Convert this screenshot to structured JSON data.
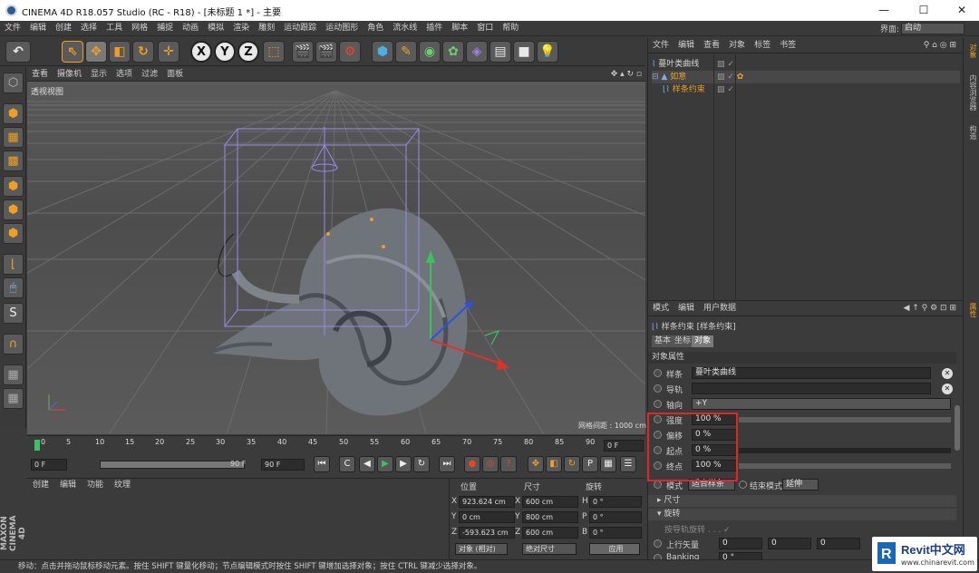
{
  "window": {
    "title": "CINEMA 4D R18.057 Studio (RC - R18) - [未标题 1 *] - 主要",
    "minimize": "—",
    "maximize": "☐",
    "close": "✕"
  },
  "menu": {
    "items": [
      "文件",
      "编辑",
      "创建",
      "选择",
      "工具",
      "网格",
      "捕捉",
      "动画",
      "模拟",
      "渲染",
      "雕刻",
      "运动跟踪",
      "运动图形",
      "角色",
      "流水线",
      "插件",
      "脚本",
      "窗口",
      "帮助"
    ],
    "layout_label": "界面:",
    "layout_value": "启动"
  },
  "viewport": {
    "menu": [
      "查看",
      "摄像机",
      "显示",
      "选项",
      "过滤",
      "面板"
    ],
    "label": "透视视图",
    "grid_spacing": "网格间距 : 1000 cm"
  },
  "timeline": {
    "ticks": [
      "0",
      "5",
      "10",
      "15",
      "20",
      "25",
      "30",
      "35",
      "40",
      "45",
      "50",
      "55",
      "60",
      "65",
      "70",
      "75",
      "80",
      "85",
      "90"
    ],
    "current_frame": "0 F"
  },
  "transport": {
    "start": "0 F",
    "min": "0 F",
    "max": "90 F",
    "end": "90 F"
  },
  "material_panel": {
    "menu": [
      "创建",
      "编辑",
      "功能",
      "纹理"
    ]
  },
  "coords": {
    "headers": [
      "位置",
      "尺寸",
      "旋转"
    ],
    "rows": [
      {
        "axis": "X",
        "pos": "923.624 cm",
        "saxis": "X",
        "size": "600 cm",
        "raxis": "H",
        "rot": "0 °"
      },
      {
        "axis": "Y",
        "pos": "0 cm",
        "saxis": "Y",
        "size": "800 cm",
        "raxis": "P",
        "rot": "0 °"
      },
      {
        "axis": "Z",
        "pos": "-593.623 cm",
        "saxis": "Z",
        "size": "600 cm",
        "raxis": "B",
        "rot": "0 °"
      }
    ],
    "mode1": "对象 (相对)",
    "mode2": "绝对尺寸",
    "apply": "应用"
  },
  "objects": {
    "menu": [
      "文件",
      "编辑",
      "查看",
      "对象",
      "标签",
      "书签"
    ],
    "items": [
      {
        "name": "蔓叶类曲线",
        "color": "#d8d8d8"
      },
      {
        "name": "如意",
        "color": "#e8a020"
      },
      {
        "name": "样条约束",
        "color": "#e8a020"
      }
    ]
  },
  "attributes": {
    "menu": [
      "模式",
      "编辑",
      "用户数据"
    ],
    "title": "样条约束 [样条约束]",
    "tabs": [
      "基本",
      "坐标",
      "对象"
    ],
    "section": "对象属性",
    "spline_label": "样条",
    "spline_value": "蔓叶类曲线",
    "rail_label": "导轨",
    "axis_label": "轴向",
    "axis_value": "+Y",
    "strength_label": "强度",
    "strength_value": "100 %",
    "strength_fraction": 1,
    "offset_label": "偏移",
    "offset_value": "0 %",
    "offset_fraction": 0,
    "start_label": "起点",
    "start_value": "0 %",
    "start_fraction": 0,
    "end_label": "终点",
    "end_value": "100 %",
    "end_fraction": 1,
    "mode_label": "模式",
    "mode_value": "适合样条",
    "endmode_label": "结束模式",
    "endmode_value": "延伸",
    "size_section": "尺寸",
    "rotate_section": "旋转",
    "banking_label": "Banking",
    "banking_value": "0 °",
    "upvec_label": "上行矢量",
    "rail_rot_label": "按导轨旋转"
  },
  "right_tabs": [
    "对象",
    "内容浏览器",
    "构造",
    "属性"
  ],
  "status": "移动：点击并拖动鼠标移动元素。按住 SHIFT 键量化移动；节点编辑模式时按住 SHIFT 键增加选择对象；按住 CTRL 键减少选择对象。",
  "brand": "MAXON CINEMA 4D",
  "watermark": {
    "brand": "Revit中文网",
    "url": "www.chinarevit.com"
  },
  "colors": {
    "accent_orange": "#f0a020",
    "bbox": "#9a88ee",
    "highlight": "#e32525"
  }
}
